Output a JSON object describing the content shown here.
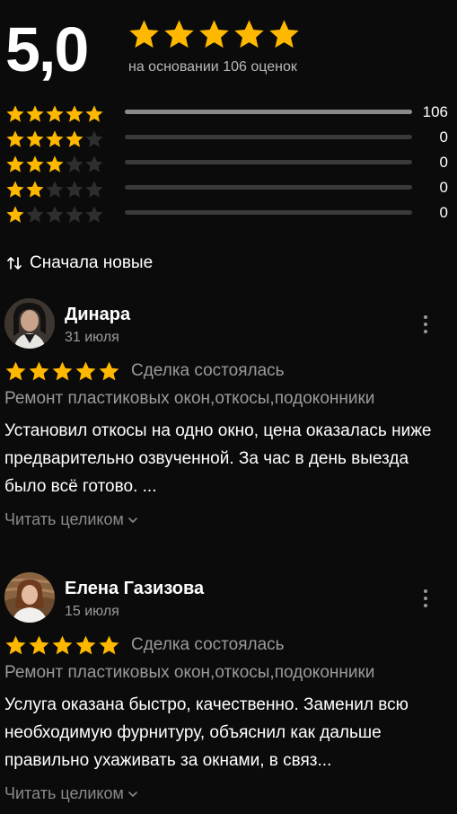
{
  "summary": {
    "score": "5,0",
    "stars": 5,
    "based_on": "на основании 106 оценок",
    "star_color": "#ffb800"
  },
  "distribution": [
    {
      "stars": 5,
      "count": "106",
      "fill": 1.0
    },
    {
      "stars": 4,
      "count": "0",
      "fill": 0
    },
    {
      "stars": 3,
      "count": "0",
      "fill": 0
    },
    {
      "stars": 2,
      "count": "0",
      "fill": 0
    },
    {
      "stars": 1,
      "count": "0",
      "fill": 0
    }
  ],
  "sort": {
    "icon": "sort-arrows-icon",
    "label": "Сначала новые"
  },
  "reviews": [
    {
      "name": "Динара",
      "date": "31 июля",
      "rating": 5,
      "status": "Сделка состоялась",
      "categories": "Ремонт пластиковых окон,откосы,подоконники",
      "text": "Установил откосы на одно окно, цена оказалась ниже предварительно озвученной. За час в день выезда было всё готово. ...",
      "read_more": "Читать целиком"
    },
    {
      "name": "Елена Газизова",
      "date": "15 июля",
      "rating": 5,
      "status": "Сделка состоялась",
      "categories": "Ремонт пластиковых окон,откосы,подоконники",
      "text": "Услуга оказана быстро, качественно. Заменил всю необходимую фурнитуру, объяснил как дальше правильно ухаживать за окнами, в связ...",
      "read_more": "Читать целиком"
    }
  ]
}
